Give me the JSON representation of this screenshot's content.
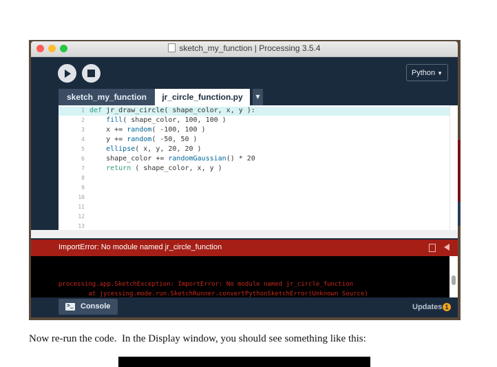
{
  "window": {
    "title": "sketch_my_function | Processing 3.5.4"
  },
  "toolbar": {
    "run_icon": "play-icon",
    "stop_icon": "stop-icon",
    "mode_label": "Python",
    "mode_caret": "▼"
  },
  "tabs": [
    {
      "label": "sketch_my_function"
    },
    {
      "label": "jr_circle_function.py"
    }
  ],
  "tab_menu": "▼",
  "editor": {
    "line_numbers": [
      "1",
      "2",
      "3",
      "4",
      "5",
      "6",
      "7",
      "8",
      "9",
      "10",
      "11",
      "12",
      "13"
    ]
  },
  "error": {
    "message": "ImportError: No module named jr_circle_function"
  },
  "console": {
    "lines": [
      "processing.app.SketchException: ImportError: No module named jr_circle_function",
      "        at jycessing.mode.run.SketchRunner.convertPythonSketchError(Unknown Source)"
    ]
  },
  "footer": {
    "console_label": "Console",
    "updates_label": "Updates",
    "updates_count": "1"
  },
  "document": {
    "instruction": "Now re-run the code.  In the Display window, you should see something like this:"
  },
  "colors": {
    "accent": "#1b2b3e",
    "error": "#a51f17"
  }
}
